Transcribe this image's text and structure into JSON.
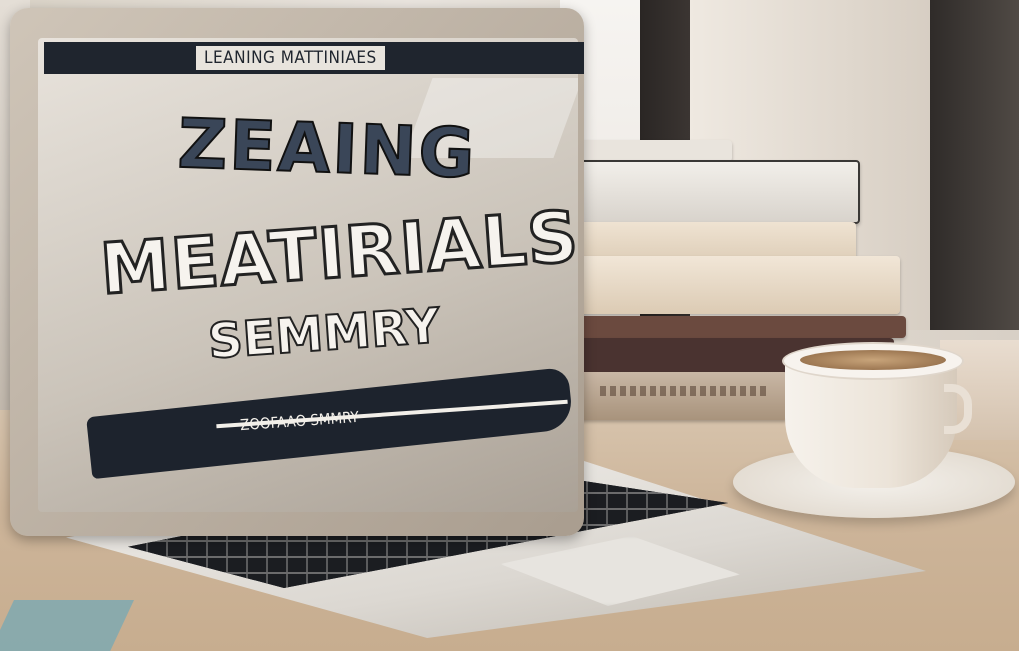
{
  "scene": {
    "description_label": "Photograph",
    "laptop_screen": {
      "header_text": "LEANING MATTINIAES",
      "title_line_1": "ZEAING",
      "title_line_2": "MEATIRIALS",
      "title_line_3": "SEMMRY",
      "subtitle": "ZOOFAAO SMMRY"
    },
    "colors": {
      "screen_header_bg": "#1f252e",
      "title_dark": "#3a4658",
      "title_light": "#f6f3ee",
      "desk": "#cdb59a"
    }
  }
}
